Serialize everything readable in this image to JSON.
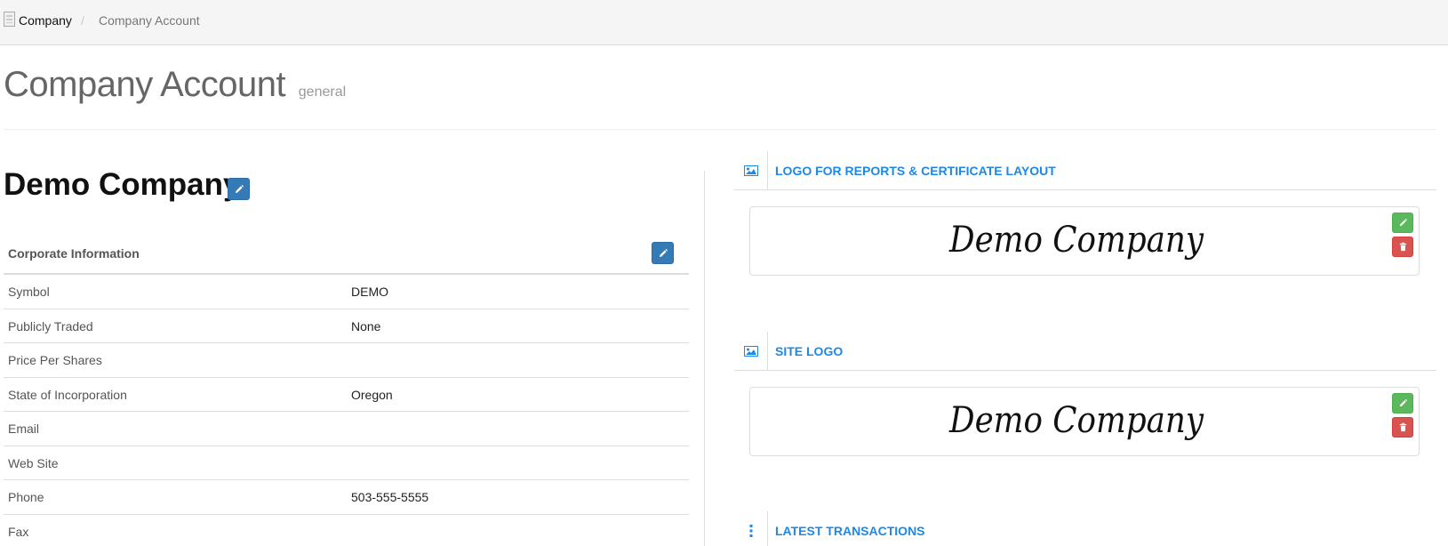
{
  "breadcrumb": {
    "home_icon": "building-icon",
    "home_label": "Company",
    "separator": "/",
    "current": "Company Account"
  },
  "page": {
    "title": "Company Account",
    "subtitle": "general"
  },
  "company": {
    "name": "Demo Company",
    "edit_icon": "pencil-icon"
  },
  "corporate_info": {
    "heading": "Corporate Information",
    "rows": [
      {
        "label": "Symbol",
        "value": "DEMO"
      },
      {
        "label": "Publicly Traded",
        "value": "None"
      },
      {
        "label": "Price Per Shares",
        "value": ""
      },
      {
        "label": "State of Incorporation",
        "value": "Oregon"
      },
      {
        "label": "Email",
        "value": ""
      },
      {
        "label": "Web Site",
        "value": ""
      },
      {
        "label": "Phone",
        "value": "503-555-5555"
      },
      {
        "label": "Fax",
        "value": ""
      }
    ]
  },
  "panels": {
    "report_logo": {
      "title": "LOGO FOR REPORTS & CERTIFICATE LAYOUT",
      "icon": "image-icon",
      "logo_text": "Demo Company"
    },
    "site_logo": {
      "title": "SITE LOGO",
      "icon": "image-icon",
      "logo_text": "Demo Company"
    },
    "latest_transactions": {
      "title": "LATEST TRANSACTIONS",
      "icon": "vertical-ellipsis-icon"
    }
  },
  "colors": {
    "primary": "#337ab7",
    "success": "#5cb85c",
    "danger": "#d9534f",
    "panel_title": "#1e88e5"
  }
}
